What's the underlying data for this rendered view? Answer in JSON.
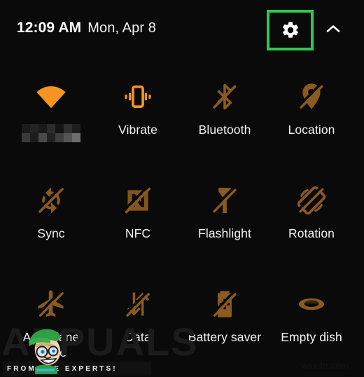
{
  "statusbar": {
    "time": "12:09 AM",
    "date": "Mon, Apr 8",
    "settings_icon": "gear-icon",
    "collapse_icon": "chevron-up-icon",
    "highlight_color": "#2ec94f"
  },
  "colors": {
    "background": "#0a0a0a",
    "icon_on": "#f79421",
    "icon_off": "#8a5a1e",
    "label": "#f4f4f4",
    "highlight": "#2ec94f"
  },
  "tiles": [
    [
      {
        "label": "",
        "label_censored": true,
        "icon": "wifi-icon",
        "state": "on"
      },
      {
        "label": "Vibrate",
        "icon": "vibrate-icon",
        "state": "on"
      },
      {
        "label": "Bluetooth",
        "icon": "bluetooth-off-icon",
        "state": "off"
      },
      {
        "label": "Location",
        "icon": "location-off-icon",
        "state": "off"
      }
    ],
    [
      {
        "label": "Sync",
        "icon": "sync-off-icon",
        "state": "off"
      },
      {
        "label": "NFC",
        "icon": "nfc-off-icon",
        "state": "off"
      },
      {
        "label": "Flashlight",
        "icon": "flashlight-off-icon",
        "state": "off"
      },
      {
        "label": "Rotation",
        "icon": "rotation-off-icon",
        "state": "off"
      }
    ],
    [
      {
        "label": "Aeroplane mode",
        "icon": "airplane-off-icon",
        "state": "off"
      },
      {
        "label": "Data",
        "icon": "mobile-data-off-icon",
        "state": "off"
      },
      {
        "label": "Battery saver",
        "icon": "battery-saver-off-icon",
        "state": "off"
      },
      {
        "label": "Empty dish",
        "icon": "dish-icon",
        "state": "off"
      }
    ]
  ],
  "watermark": {
    "word": "APPUALS",
    "tagline": "FROM THE EXPERTS!",
    "site": "wsxdn.com"
  }
}
